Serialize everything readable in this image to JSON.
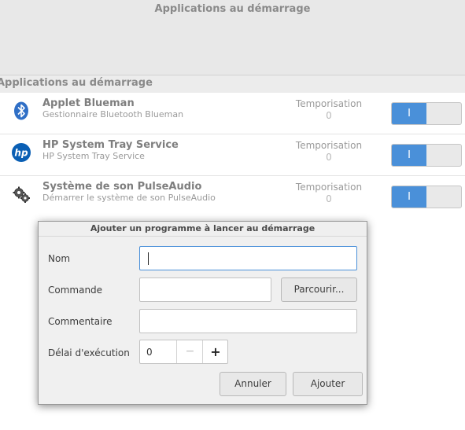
{
  "window": {
    "title": "Applications au démarrage"
  },
  "section": {
    "header": "Applications au démarrage"
  },
  "apps": [
    {
      "name": "Applet Blueman",
      "description": "Gestionnaire Bluetooth Blueman",
      "delay_label": "Temporisation",
      "delay_value": "0",
      "enabled": true,
      "toggle_label": "I",
      "icon": "bluetooth-icon"
    },
    {
      "name": "HP System Tray Service",
      "description": "HP System Tray Service",
      "delay_label": "Temporisation",
      "delay_value": "0",
      "enabled": true,
      "toggle_label": "I",
      "icon": "hp-logo-icon"
    },
    {
      "name": "Système de son PulseAudio",
      "description": "Démarrer le système de son PulseAudio",
      "delay_label": "Temporisation",
      "delay_value": "0",
      "enabled": true,
      "toggle_label": "I",
      "icon": "gears-icon"
    }
  ],
  "dialog": {
    "title": "Ajouter un programme à lancer au démarrage",
    "name_label": "Nom",
    "name_value": "",
    "command_label": "Commande",
    "command_value": "",
    "browse_label": "Parcourir...",
    "comment_label": "Commentaire",
    "comment_value": "",
    "delay_label": "Délai d'exécution",
    "delay_value": "0",
    "minus_label": "−",
    "plus_label": "+",
    "cancel_label": "Annuler",
    "add_label": "Ajouter"
  },
  "colors": {
    "accent": "#4a90d9",
    "hp_blue": "#0a5fb4"
  }
}
